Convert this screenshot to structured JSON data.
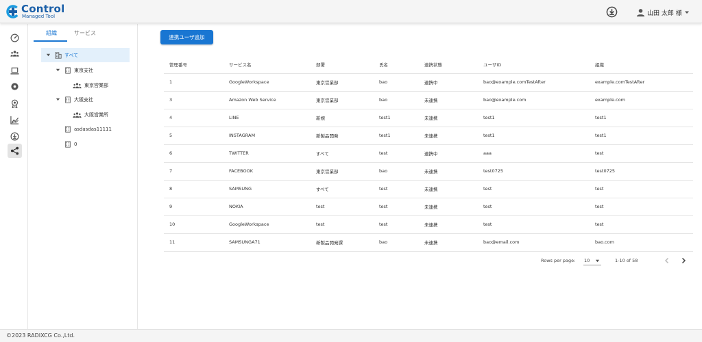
{
  "app": {
    "logo_text": "Control",
    "logo_subtitle": "Managed Tool",
    "logo_color": "#1a5fa8"
  },
  "header": {
    "user_name": "山田 太郎 様",
    "icons": [
      "download-icon",
      "account-icon",
      "caret-down-icon"
    ]
  },
  "rail": {
    "items": [
      {
        "name": "dashboard-icon"
      },
      {
        "name": "users-icon"
      },
      {
        "name": "laptop-icon"
      },
      {
        "name": "record-icon"
      },
      {
        "name": "badge-icon"
      },
      {
        "name": "chart-icon"
      },
      {
        "name": "download-circle-icon"
      },
      {
        "name": "share-icon",
        "active": true
      }
    ]
  },
  "tree": {
    "tabs": [
      "組織",
      "サービス"
    ],
    "active_tab": 0,
    "nodes": [
      {
        "label": "すべて",
        "type": "building",
        "level": 0,
        "expanded": true,
        "selected": true
      },
      {
        "label": "東京支社",
        "type": "building",
        "level": 1,
        "expanded": true
      },
      {
        "label": "東京営業部",
        "type": "group",
        "level": 2
      },
      {
        "label": "大阪支社",
        "type": "building",
        "level": 1,
        "expanded": true
      },
      {
        "label": "大阪営業所",
        "type": "group",
        "level": 2
      },
      {
        "label": "asdasdas11111",
        "type": "building",
        "level": 1
      },
      {
        "label": "0",
        "type": "building",
        "level": 1
      }
    ]
  },
  "main": {
    "add_button_label": "連携ユーザ追加",
    "accent_color": "#1976d2",
    "table": {
      "columns": [
        "管理番号",
        "サービス名",
        "部署",
        "氏名",
        "連携状態",
        "ユーザID",
        "組織"
      ],
      "rows": [
        [
          "1",
          "GoogleWorkspace",
          "東京営業部",
          "bao",
          "連携中",
          "bao@example.comTestAfter",
          "example.comTestAfter"
        ],
        [
          "3",
          "Amazon Web Service",
          "東京営業部",
          "bao",
          "未連携",
          "bao@example.com",
          "example.com"
        ],
        [
          "4",
          "LINE",
          "新規",
          "test1",
          "未連携",
          "test1",
          "test1"
        ],
        [
          "5",
          "INSTAGRAM",
          "新製品開発",
          "test1",
          "未連携",
          "test1",
          "test1"
        ],
        [
          "6",
          "TWITTER",
          "すべて",
          "test",
          "連携中",
          "aaa",
          "test"
        ],
        [
          "7",
          "FACEBOOK",
          "東京営業部",
          "bao",
          "未連携",
          "test0725",
          "test0725"
        ],
        [
          "8",
          "SAMSUNG",
          "すべて",
          "test",
          "未連携",
          "test",
          "test"
        ],
        [
          "9",
          "NOKIA",
          "test",
          "test",
          "未連携",
          "test",
          "test"
        ],
        [
          "10",
          "GoogleWorkspace",
          "test",
          "test",
          "未連携",
          "test",
          "test"
        ],
        [
          "11",
          "SAMSUNGA71",
          "新製品開発課",
          "bao",
          "未連携",
          "bao@email.com",
          "bao.com"
        ]
      ]
    },
    "pagination": {
      "rows_per_page_label": "Rows per page:",
      "rows_per_page": "10",
      "range": "1-10 of 58"
    }
  },
  "footer": {
    "copyright": "©2023 RADIXCG Co.,Ltd."
  }
}
